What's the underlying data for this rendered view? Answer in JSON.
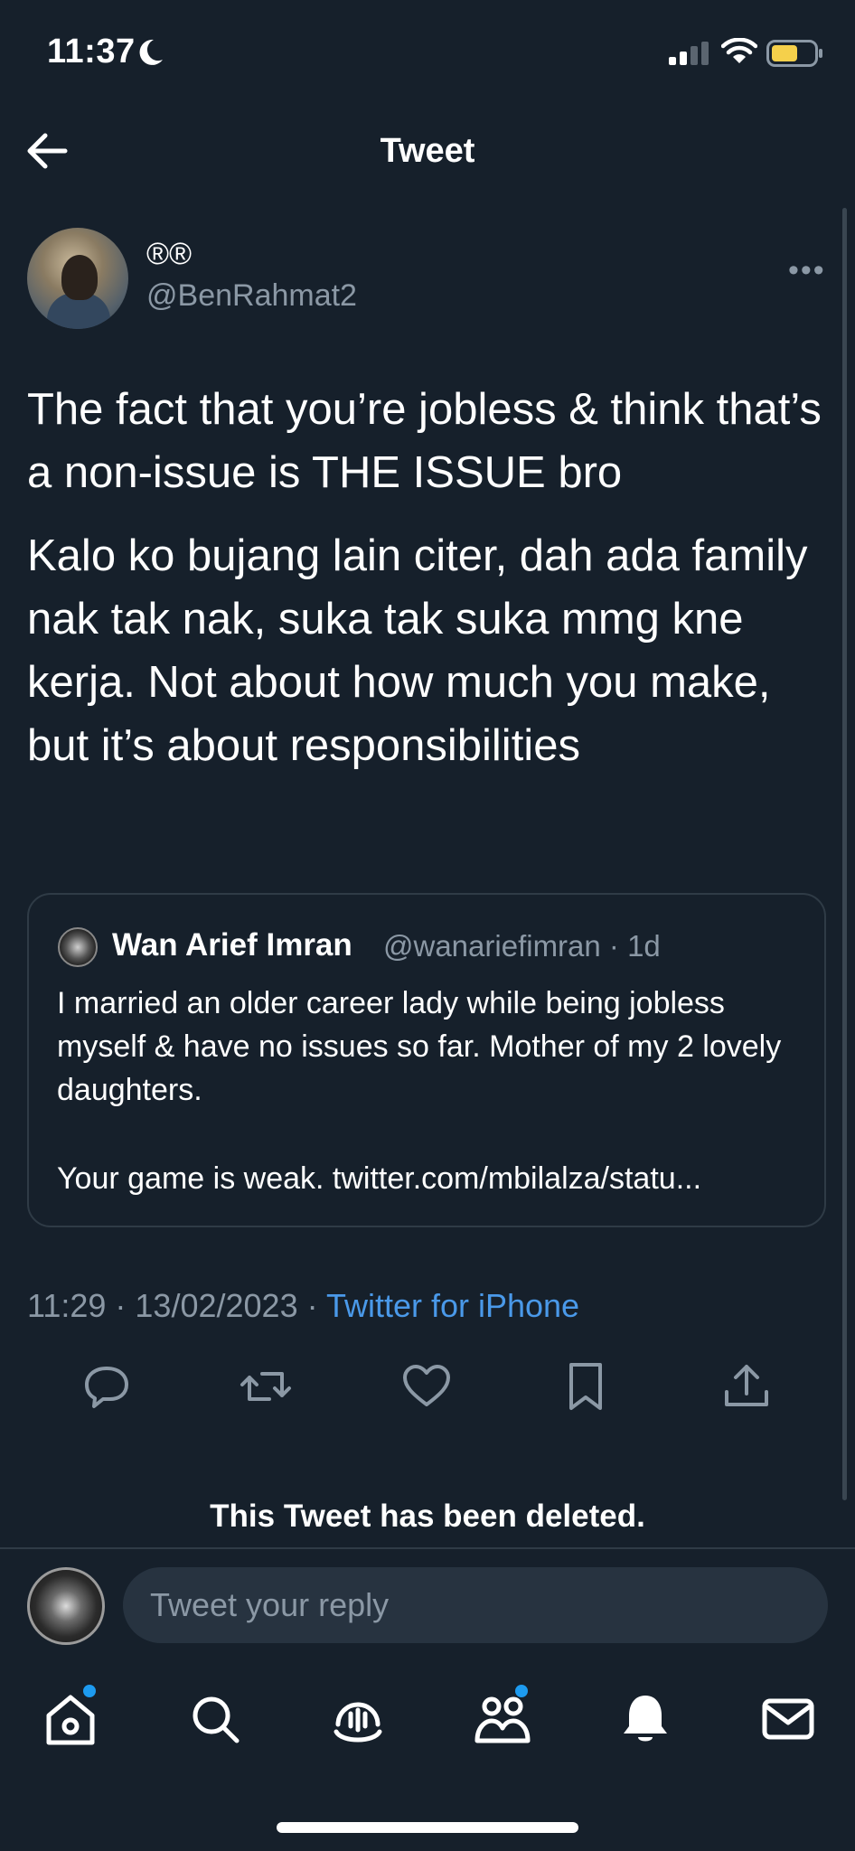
{
  "status_bar": {
    "time": "11:37"
  },
  "header": {
    "title": "Tweet"
  },
  "tweet": {
    "author_name": "®®",
    "author_handle": "@BenRahmat2",
    "paragraphs": [
      "The fact that you’re jobless & think that’s a non-issue is THE ISSUE bro",
      "Kalo ko bujang lain citer, dah ada family nak tak nak, suka tak suka mmg kne kerja. Not about how much you make, but it’s about responsibilities"
    ],
    "quoted": {
      "name": "Wan Arief Imran",
      "handle_time": "@wanariefimran · 1d",
      "text": "I married an older career lady while being jobless myself & have no issues so far. Mother of my 2 lovely daughters.",
      "link_text": "Your game is weak. twitter.com/mbilalza/statu..."
    },
    "timestamp": "11:29 · 13/02/2023 · ",
    "source": "Twitter for iPhone"
  },
  "deleted_notice": "This Tweet has been deleted.",
  "reply": {
    "placeholder": "Tweet your reply"
  },
  "icons": {
    "actions": [
      "reply-icon",
      "retweet-icon",
      "like-icon",
      "bookmark-icon",
      "share-icon"
    ],
    "tabs": [
      "home-icon",
      "search-icon",
      "spaces-icon",
      "communities-icon",
      "notifications-icon",
      "messages-icon"
    ]
  },
  "colors": {
    "background": "#16202b",
    "accent": "#1d9bf0",
    "link": "#4a99e9",
    "muted": "#8b98a5"
  }
}
